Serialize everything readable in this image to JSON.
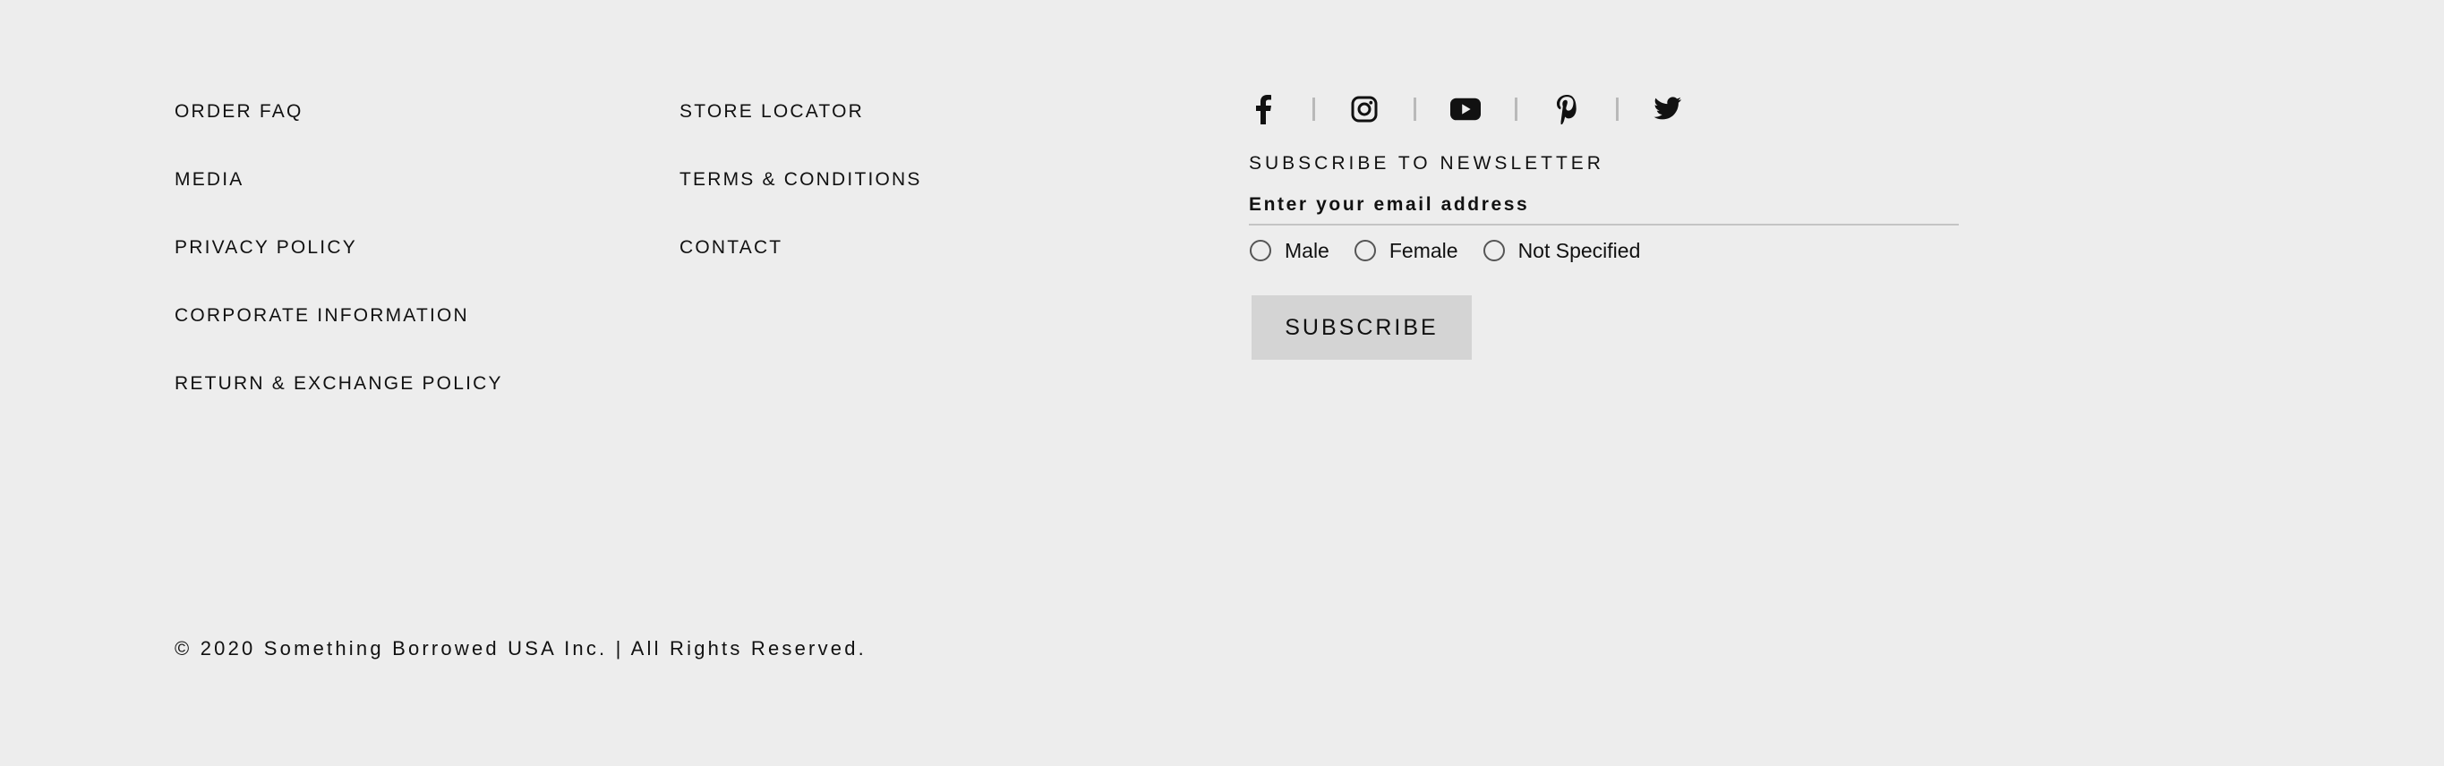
{
  "footer": {
    "links_col1": [
      "ORDER FAQ",
      "MEDIA",
      "PRIVACY POLICY",
      "CORPORATE INFORMATION",
      "RETURN & EXCHANGE POLICY"
    ],
    "links_col2": [
      "STORE LOCATOR",
      "TERMS & CONDITIONS",
      "CONTACT"
    ],
    "social": [
      {
        "icon": "facebook-icon"
      },
      {
        "icon": "instagram-icon"
      },
      {
        "icon": "youtube-icon"
      },
      {
        "icon": "pinterest-icon"
      },
      {
        "icon": "twitter-icon"
      }
    ],
    "newsletter": {
      "title": "SUBSCRIBE TO NEWSLETTER",
      "email_placeholder": "Enter your email address",
      "gender_options": [
        "Male",
        "Female",
        "Not Specified"
      ],
      "subscribe_label": "SUBSCRIBE"
    },
    "copyright": "© 2020 Something Borrowed USA Inc. | All Rights Reserved."
  },
  "colors": {
    "background": "#ededed",
    "text": "#111111",
    "button_bg": "#d4d4d4",
    "separator": "#b9b9b9"
  }
}
